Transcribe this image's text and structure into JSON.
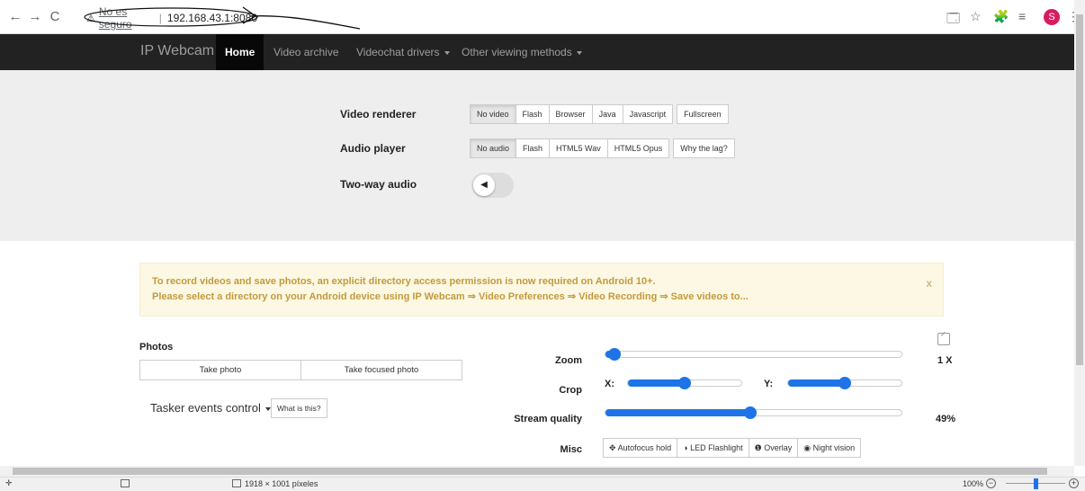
{
  "browser": {
    "back": "←",
    "forward": "→",
    "reload": "C",
    "not_secure": "No es seguro",
    "separator": "|",
    "url": "192.168.43.1:8080",
    "warning_glyph": "⚠",
    "translate_icon": "🗔",
    "star_icon": "☆",
    "extensions_icon": "🧩",
    "media_icon": "≡",
    "avatar_letter": "S",
    "menu_icon": "⋮"
  },
  "navbar": {
    "brand": "IP Webcam",
    "items": [
      {
        "label": "Home"
      },
      {
        "label": "Video archive"
      },
      {
        "label": "Videochat drivers"
      },
      {
        "label": "Other viewing methods"
      }
    ]
  },
  "settings": {
    "video_renderer": {
      "label": "Video renderer",
      "options": [
        "No video",
        "Flash",
        "Browser",
        "Java",
        "Javascript",
        "Fullscreen"
      ],
      "selected": "No video"
    },
    "audio_player": {
      "label": "Audio player",
      "options": [
        "No audio",
        "Flash",
        "HTML5 Wav",
        "HTML5 Opus",
        "Why the lag?"
      ],
      "selected": "No audio"
    },
    "two_way_audio": {
      "label": "Two-way audio",
      "icon": "◀"
    }
  },
  "alert": {
    "line1": "To record videos and save photos, an explicit directory access permission is now required on Android 10+.",
    "line2": "Please select a directory on your Android device using IP Webcam ⇒ Video Preferences ⇒ Video Recording ⇒ Save videos to...",
    "close": "x"
  },
  "photos": {
    "title": "Photos",
    "take_photo": "Take photo",
    "take_focused_photo": "Take focused photo"
  },
  "tasker": {
    "label": "Tasker events control",
    "help": "What is this?"
  },
  "controls": {
    "zoom": {
      "label": "Zoom",
      "value_text": "1 X",
      "level": 0.03
    },
    "crop": {
      "label": "Crop",
      "x_label": "X:",
      "y_label": "Y:",
      "x_level": 0.5,
      "y_level": 0.5
    },
    "stream_quality": {
      "label": "Stream quality",
      "value_text": "49%",
      "level": 0.49
    },
    "misc": {
      "label": "Misc",
      "buttons": [
        {
          "label": "Autofocus hold",
          "icon": "✥"
        },
        {
          "label": "LED Flashlight",
          "icon": "◑"
        },
        {
          "label": "Overlay",
          "icon": "❶"
        },
        {
          "label": "Night vision",
          "icon": "◉"
        }
      ]
    }
  },
  "statusbar": {
    "dimensions": "1918 × 1001 píxeles",
    "zoom": "100%",
    "zoom_out": "−",
    "zoom_in": "+"
  }
}
